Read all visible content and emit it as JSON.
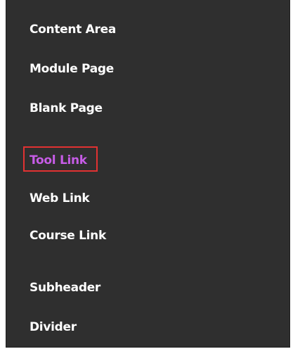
{
  "menu": {
    "items": [
      {
        "label": "Content Area"
      },
      {
        "label": "Module Page"
      },
      {
        "label": "Blank Page"
      },
      {
        "label": "Tool Link"
      },
      {
        "label": "Web Link"
      },
      {
        "label": "Course Link"
      },
      {
        "label": "Subheader"
      },
      {
        "label": "Divider"
      }
    ]
  },
  "colors": {
    "menu_background": "#2f2f2f",
    "item_text": "#ffffff",
    "active_item_text": "#c65ce6",
    "highlight_box": "#e13232"
  }
}
